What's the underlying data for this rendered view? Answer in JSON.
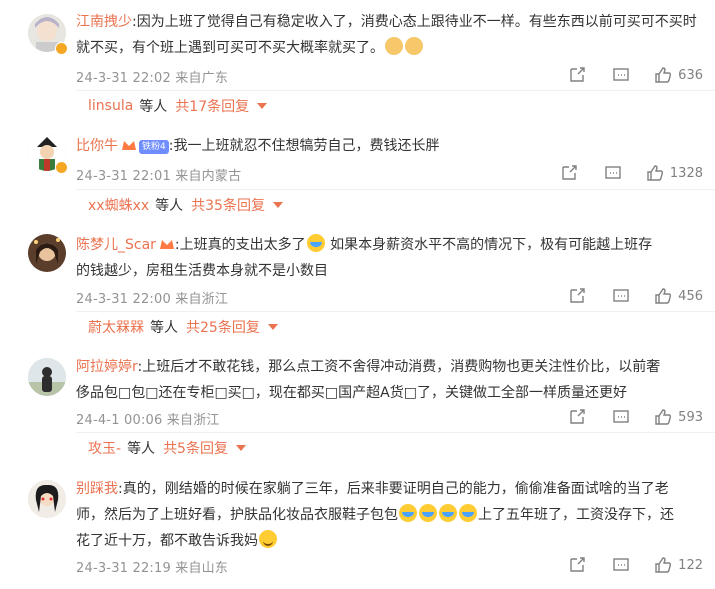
{
  "comments": [
    {
      "user": "江南拽少",
      "text_parts": [
        ":因为上班了觉得自己有稳定收入了，消费心态上跟待业不一样。有些东西以前可买可不买时就不买，有个班上遇到可买可不买大概率就买了。"
      ],
      "time": "24-3-31 22:02 来自广东",
      "likes": "636",
      "reply_user": "linsula",
      "reply_etc": "等人",
      "reply_count": "共17条回复"
    },
    {
      "user": "比你牛",
      "fan_badge": "铁粉4",
      "text": ":我一上班就忍不住想犒劳自己，费钱还长胖",
      "time": "24-3-31 22:01 来自内蒙古",
      "likes": "1328",
      "reply_user": "xx蜘蛛xx",
      "reply_etc": "等人",
      "reply_count": "共35条回复"
    },
    {
      "user": "陈梦儿_Scar",
      "text_line1": ":上班真的支出太多了",
      "text_line1b": "  如果本身薪资水平不高的情况下，极有可能越上班存",
      "text_line2": "的钱越少，房租生活费本身就不是小数目",
      "time": "24-3-31 22:00 来自浙江",
      "likes": "456",
      "reply_user": "蔚太槑槑",
      "reply_etc": "等人",
      "reply_count": "共25条回复"
    },
    {
      "user": "阿拉婷婷r",
      "text_line1": ":上班后才不敢花钱，那么点工资不舍得冲动消费，消费购物也更关注性价比，以前奢",
      "text_line2": "侈品包□包□还在专柜□买□，现在都买□国产超A货□了，关键做工全部一样质量还更好",
      "time": "24-4-1 00:06 来自浙江",
      "likes": "593",
      "reply_user": "攻玉-",
      "reply_etc": "等人",
      "reply_count": "共5条回复"
    },
    {
      "user": "别踩我",
      "text_line1": ":真的，刚结婚的时候在家躺了三年，后来非要证明自己的能力，偷偷准备面试啥的当了老",
      "text_line2a": "师，然后为了上班好看，护肤品化妆品衣服鞋子包包",
      "text_line2b": "上了五年班了，工资没存下，还",
      "text_line3": "花了近十万，都不敢告诉我妈",
      "time": "24-3-31 22:19 来自山东",
      "likes": "122"
    }
  ],
  "colors": {
    "username": "#eb7350",
    "meta": "#939393",
    "icon": "#808080"
  },
  "icons": [
    "share-icon",
    "comment-icon",
    "like-icon",
    "chevron-down-icon",
    "vip-badge-icon",
    "crown-badge-icon"
  ]
}
